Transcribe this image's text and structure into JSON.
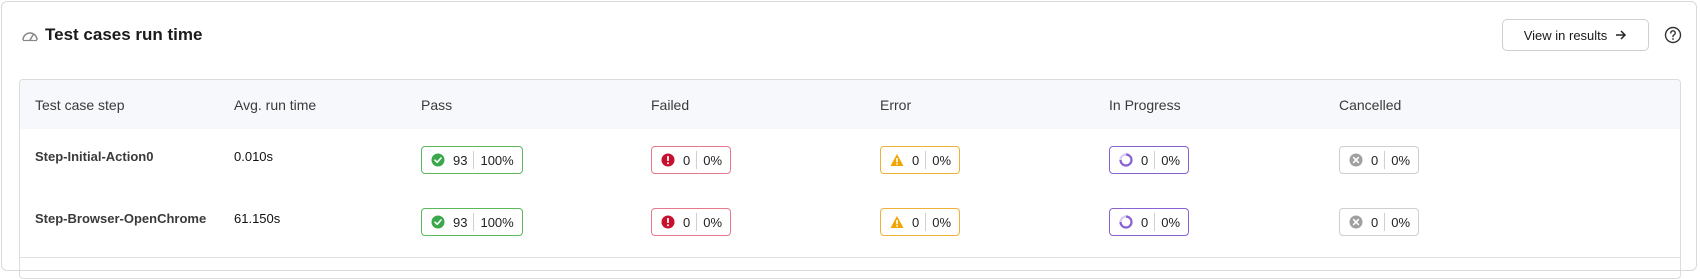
{
  "header": {
    "title": "Test cases run time",
    "title_icon": "speedometer-icon",
    "view_button_label": "View in results",
    "view_button_icon": "arrow-right-icon",
    "help_icon": "question-circle-icon"
  },
  "table": {
    "columns": [
      "Test case step",
      "Avg. run time",
      "Pass",
      "Failed",
      "Error",
      "In Progress",
      "Cancelled"
    ],
    "rows": [
      {
        "step": "Step-Initial-Action0",
        "avg_time": "0.010s",
        "pass": {
          "count": "93",
          "pct": "100%"
        },
        "failed": {
          "count": "0",
          "pct": "0%"
        },
        "error": {
          "count": "0",
          "pct": "0%"
        },
        "in_progress": {
          "count": "0",
          "pct": "0%"
        },
        "cancelled": {
          "count": "0",
          "pct": "0%"
        }
      },
      {
        "step": "Step-Browser-OpenChrome",
        "avg_time": "61.150s",
        "pass": {
          "count": "93",
          "pct": "100%"
        },
        "failed": {
          "count": "0",
          "pct": "0%"
        },
        "error": {
          "count": "0",
          "pct": "0%"
        },
        "in_progress": {
          "count": "0",
          "pct": "0%"
        },
        "cancelled": {
          "count": "0",
          "pct": "0%"
        }
      }
    ]
  },
  "colors": {
    "pass": "#3aa84a",
    "failed": "#c8102e",
    "error": "#f0a500",
    "in_progress": "#8a63d2",
    "cancelled": "#a0a0a0",
    "header_bg": "#f7f8fb"
  }
}
